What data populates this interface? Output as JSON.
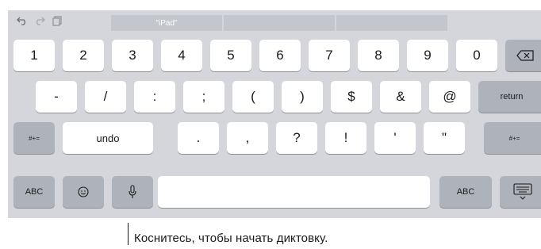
{
  "toolbar": {
    "undo_icon": "undo-arrow-icon",
    "redo_icon": "redo-arrow-icon",
    "paste_icon": "clipboard-icon"
  },
  "suggestions": [
    "\"iPad\"",
    "",
    ""
  ],
  "rows": {
    "numbers": [
      "1",
      "2",
      "3",
      "4",
      "5",
      "6",
      "7",
      "8",
      "9",
      "0"
    ],
    "delete_icon": "backspace-icon",
    "symbols": [
      "-",
      "/",
      ":",
      ";",
      "(",
      ")",
      "$",
      "&",
      "@"
    ],
    "return_label": "return",
    "shift_label_left": "#+=",
    "undo_label": "undo",
    "punct": [
      ".",
      ",",
      "?",
      "!",
      "'",
      "\""
    ],
    "shift_label_right": "#+=",
    "abc_left": "ABC",
    "emoji_icon": "emoji-icon",
    "mic_icon": "microphone-icon",
    "space_label": "",
    "abc_right": "ABC",
    "hide_keyboard_icon": "hide-keyboard-icon"
  },
  "caption": "Коснитесь, чтобы начать диктовку."
}
